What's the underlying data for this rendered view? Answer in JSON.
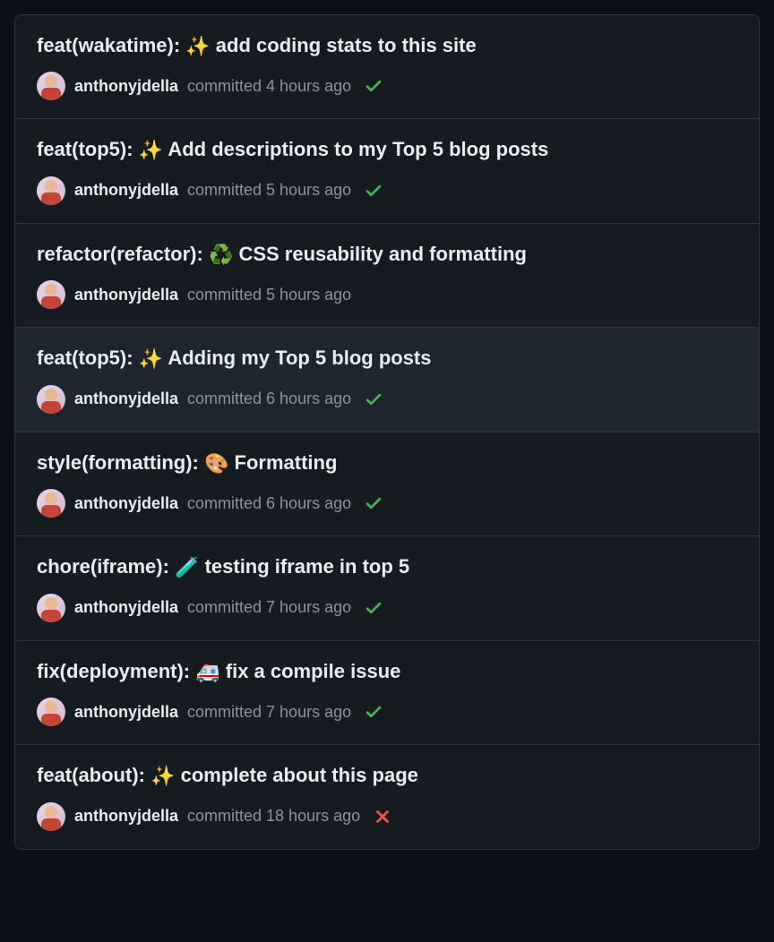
{
  "commits": [
    {
      "title_prefix": "feat(wakatime): ",
      "emoji": "✨",
      "title_suffix": " add coding stats to this site",
      "author": "anthonyjdella",
      "time": "committed 4 hours ago",
      "status": "success",
      "highlighted": false
    },
    {
      "title_prefix": "feat(top5): ",
      "emoji": "✨",
      "title_suffix": " Add descriptions to my Top 5 blog posts",
      "author": "anthonyjdella",
      "time": "committed 5 hours ago",
      "status": "success",
      "highlighted": false
    },
    {
      "title_prefix": "refactor(refactor): ",
      "emoji": "♻️",
      "title_suffix": " CSS reusability and formatting",
      "author": "anthonyjdella",
      "time": "committed 5 hours ago",
      "status": "none",
      "highlighted": false
    },
    {
      "title_prefix": "feat(top5): ",
      "emoji": "✨",
      "title_suffix": " Adding my Top 5 blog posts",
      "author": "anthonyjdella",
      "time": "committed 6 hours ago",
      "status": "success",
      "highlighted": true
    },
    {
      "title_prefix": "style(formatting): ",
      "emoji": "🎨",
      "title_suffix": " Formatting",
      "author": "anthonyjdella",
      "time": "committed 6 hours ago",
      "status": "success",
      "highlighted": false
    },
    {
      "title_prefix": "chore(iframe): ",
      "emoji": "🧪",
      "title_suffix": " testing iframe in top 5",
      "author": "anthonyjdella",
      "time": "committed 7 hours ago",
      "status": "success",
      "highlighted": false
    },
    {
      "title_prefix": "fix(deployment): ",
      "emoji": "🚑",
      "title_suffix": " fix a compile issue",
      "author": "anthonyjdella",
      "time": "committed 7 hours ago",
      "status": "success",
      "highlighted": false
    },
    {
      "title_prefix": "feat(about): ",
      "emoji": "✨",
      "title_suffix": " complete about this page",
      "author": "anthonyjdella",
      "time": "committed 18 hours ago",
      "status": "failure",
      "highlighted": false
    }
  ]
}
